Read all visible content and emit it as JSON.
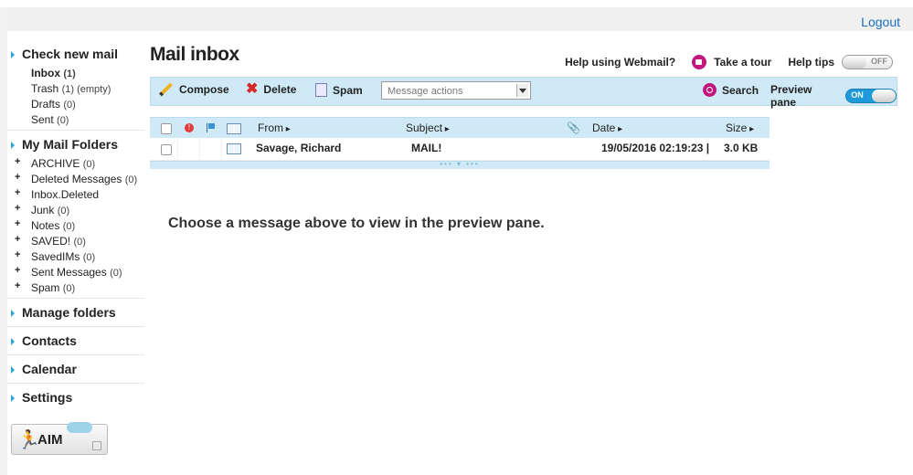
{
  "header": {
    "logout": "Logout"
  },
  "sidebar": {
    "check_new_mail": "Check new mail",
    "mailboxes": [
      {
        "label": "Inbox",
        "count": "(1)"
      },
      {
        "label": "Trash",
        "count": "(1) (empty)"
      },
      {
        "label": "Drafts",
        "count": "(0)"
      },
      {
        "label": "Sent",
        "count": "(0)"
      }
    ],
    "my_mail_folders": "My Mail Folders",
    "folders": [
      {
        "label": "ARCHIVE",
        "count": "(0)"
      },
      {
        "label": "Deleted Messages",
        "count": "(0)"
      },
      {
        "label": "Inbox.Deleted",
        "count": ""
      },
      {
        "label": "Junk",
        "count": "(0)"
      },
      {
        "label": "Notes",
        "count": "(0)"
      },
      {
        "label": "SAVED!",
        "count": "(0)"
      },
      {
        "label": "SavedIMs",
        "count": "(0)"
      },
      {
        "label": "Sent Messages",
        "count": "(0)"
      },
      {
        "label": "Spam",
        "count": "(0)"
      }
    ],
    "manage_folders": "Manage folders",
    "contacts": "Contacts",
    "calendar": "Calendar",
    "settings": "Settings",
    "aim_label": "AIM"
  },
  "main": {
    "title": "Mail inbox",
    "help_webmail": "Help using Webmail?",
    "take_tour": "Take a tour",
    "help_tips": "Help tips",
    "help_tips_state": "OFF",
    "toolbar": {
      "compose": "Compose",
      "delete": "Delete",
      "spam": "Spam",
      "message_actions_placeholder": "Message actions",
      "search": "Search",
      "preview_pane": "Preview pane",
      "preview_pane_state": "ON"
    },
    "columns": {
      "from": "From",
      "subject": "Subject",
      "date": "Date",
      "size": "Size"
    },
    "messages": [
      {
        "from": "Savage, Richard",
        "subject": "MAIL!",
        "date": "19/05/2016 02:19:23 |",
        "size": "3.0 KB"
      }
    ],
    "preview_message": "Choose a message above to view in the preview pane."
  },
  "colors": {
    "toolbar_bg": "#cfeaf6",
    "accent": "#1e9ad8",
    "link": "#1a6ec2",
    "tour_icon": "#c1177c"
  }
}
